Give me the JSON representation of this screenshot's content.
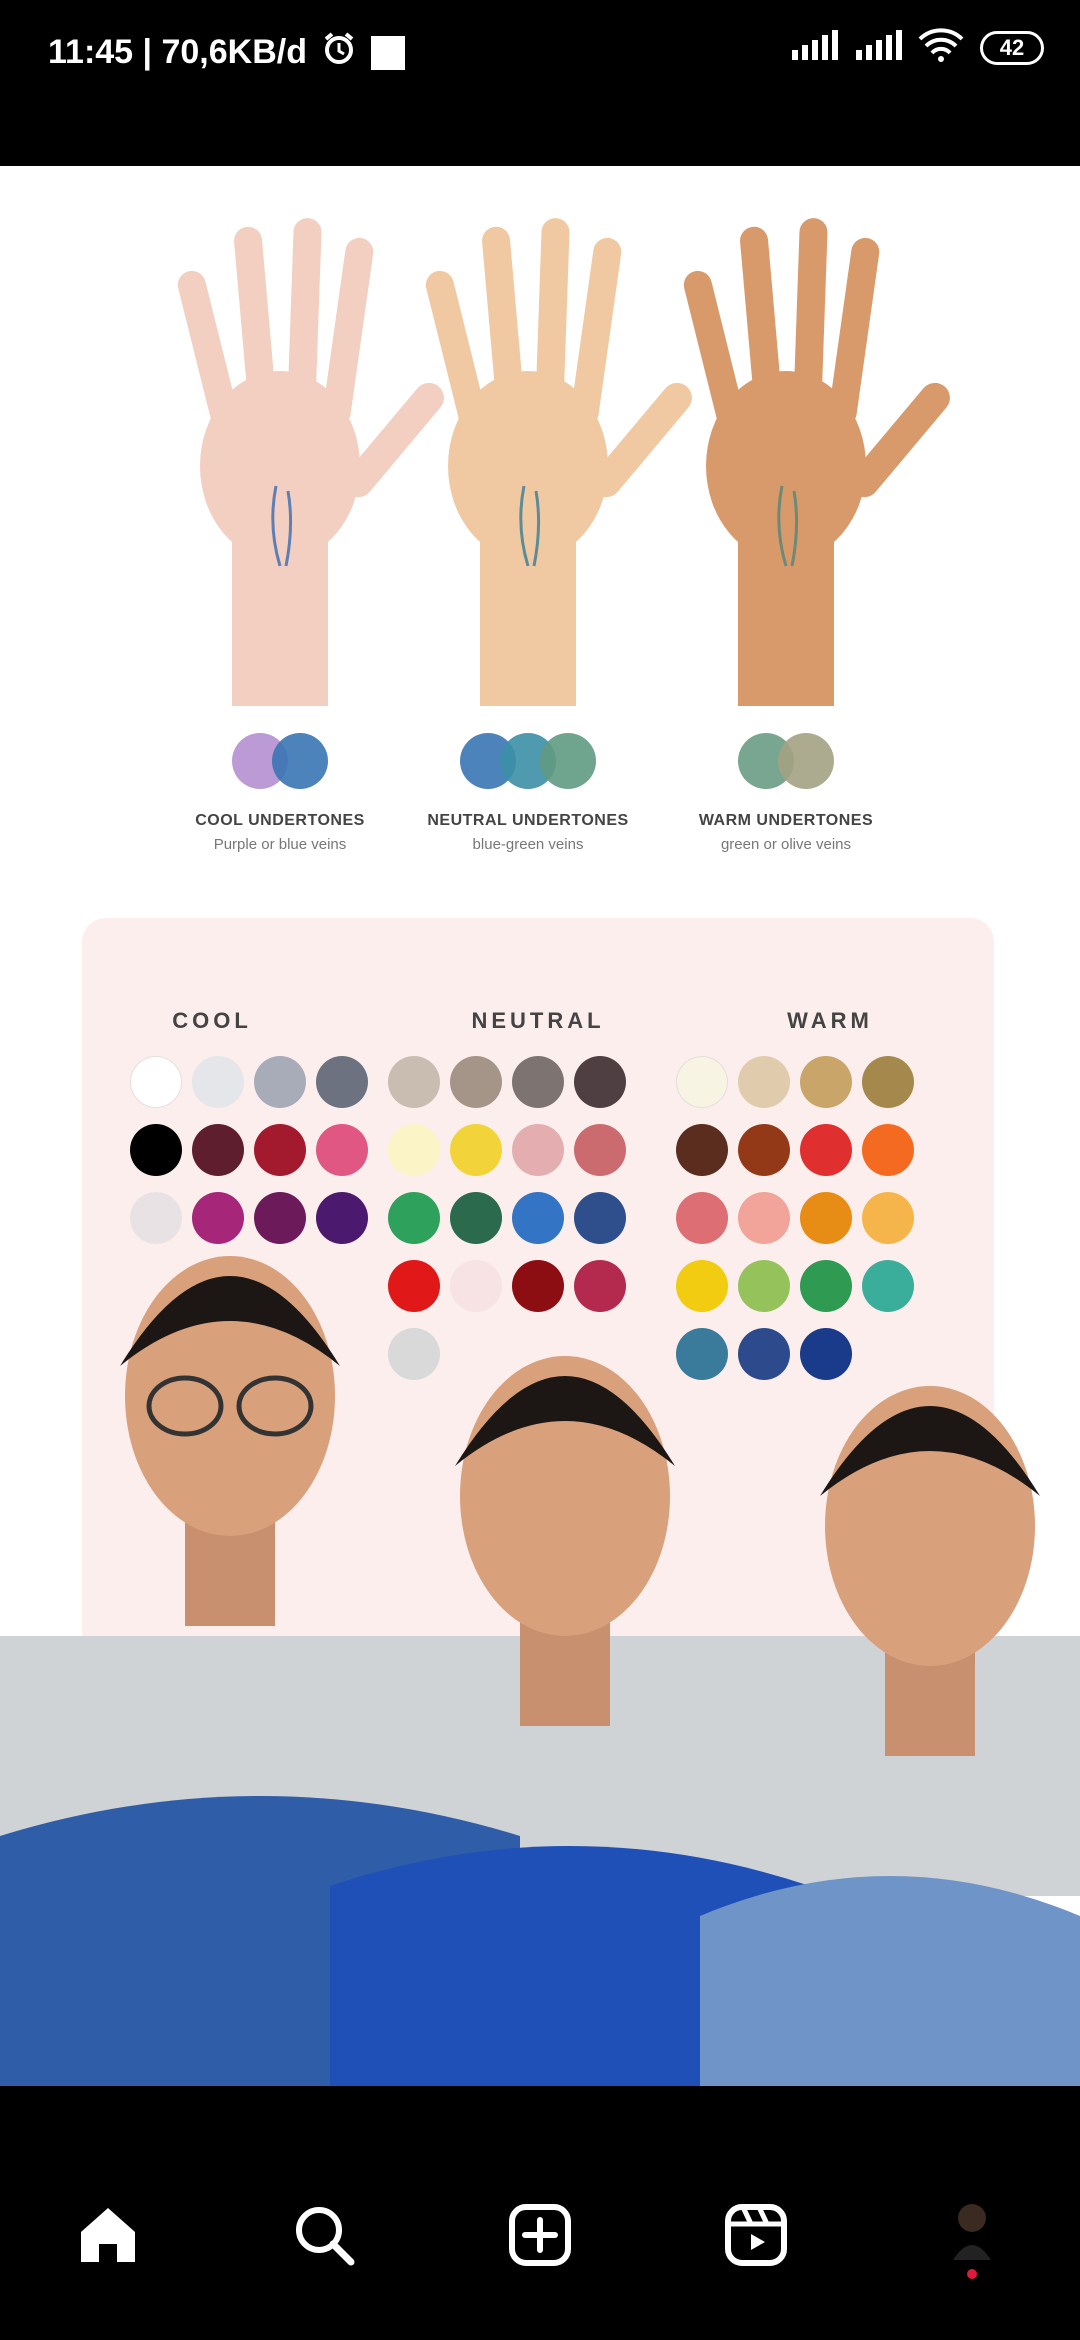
{
  "status_bar": {
    "time_text": "11:45 | 70,6KB/d",
    "battery": "42",
    "icons": [
      "alarm-icon",
      "notification-square-icon",
      "signal-icon",
      "signal-icon",
      "wifi-icon",
      "battery-icon"
    ]
  },
  "undertones": [
    {
      "title": "COOL UNDERTONES",
      "subtitle": "Purple or blue veins",
      "skin": "#f2cfc0",
      "circles": [
        "#b58fd0",
        "#3a75b4"
      ]
    },
    {
      "title": "NEUTRAL UNDERTONES",
      "subtitle": "blue-green veins",
      "skin": "#f0c9a3",
      "circles": [
        "#3a75b4",
        "#3c8fa6",
        "#5f9a82"
      ]
    },
    {
      "title": "WARM UNDERTONES",
      "subtitle": "green or olive veins",
      "skin": "#d89a6b",
      "circles": [
        "#6a9c84",
        "#a4a283"
      ]
    }
  ],
  "palettes": {
    "cool": {
      "label": "COOL",
      "rows": [
        [
          "#ffffff",
          "#e4e6ea",
          "#a8abb8",
          "#6d7280"
        ],
        [
          "#000000",
          "#5e1e2e",
          "#a3192d",
          "#e15784"
        ],
        [
          "#e9e2e4",
          "#a6267a",
          "#6d1a5a",
          "#4b1a6e"
        ]
      ]
    },
    "neutral": {
      "label": "NEUTRAL",
      "rows": [
        [
          "#c9bdb1",
          "#a59488",
          "#7d7472",
          "#4f3e42"
        ],
        [
          "#fbf4c6",
          "#f2d43a",
          "#e4adb0",
          "#cb6b70"
        ],
        [
          "#2ea25c",
          "#2b6a4d",
          "#3474c4",
          "#2e4f8c"
        ],
        [
          "#e01818",
          "#f7e3e3",
          "#8c0e12",
          "#b42a4e"
        ],
        [
          "#d9d9d9"
        ]
      ]
    },
    "warm": {
      "label": "WARM",
      "rows": [
        [
          "#f8f4e4",
          "#e0ccad",
          "#c9a56a",
          "#a5884c"
        ],
        [
          "#5b2d1e",
          "#933918",
          "#df2f2f",
          "#f36a20"
        ],
        [
          "#dd6f74",
          "#f2a39a",
          "#e78c14",
          "#f5b54a"
        ],
        [
          "#f2cc10",
          "#95c25a",
          "#2e9a52",
          "#3aae9a"
        ],
        [
          "#3a7a9a",
          "#2d4b8c",
          "#1a3a8a"
        ]
      ]
    }
  },
  "people": {
    "shirt_colors": [
      "#2f5da8",
      "#1e50b8",
      "#6f95c8"
    ]
  },
  "nav": {
    "items": [
      "home-icon",
      "search-icon",
      "create-icon",
      "reels-icon",
      "profile-avatar"
    ]
  }
}
